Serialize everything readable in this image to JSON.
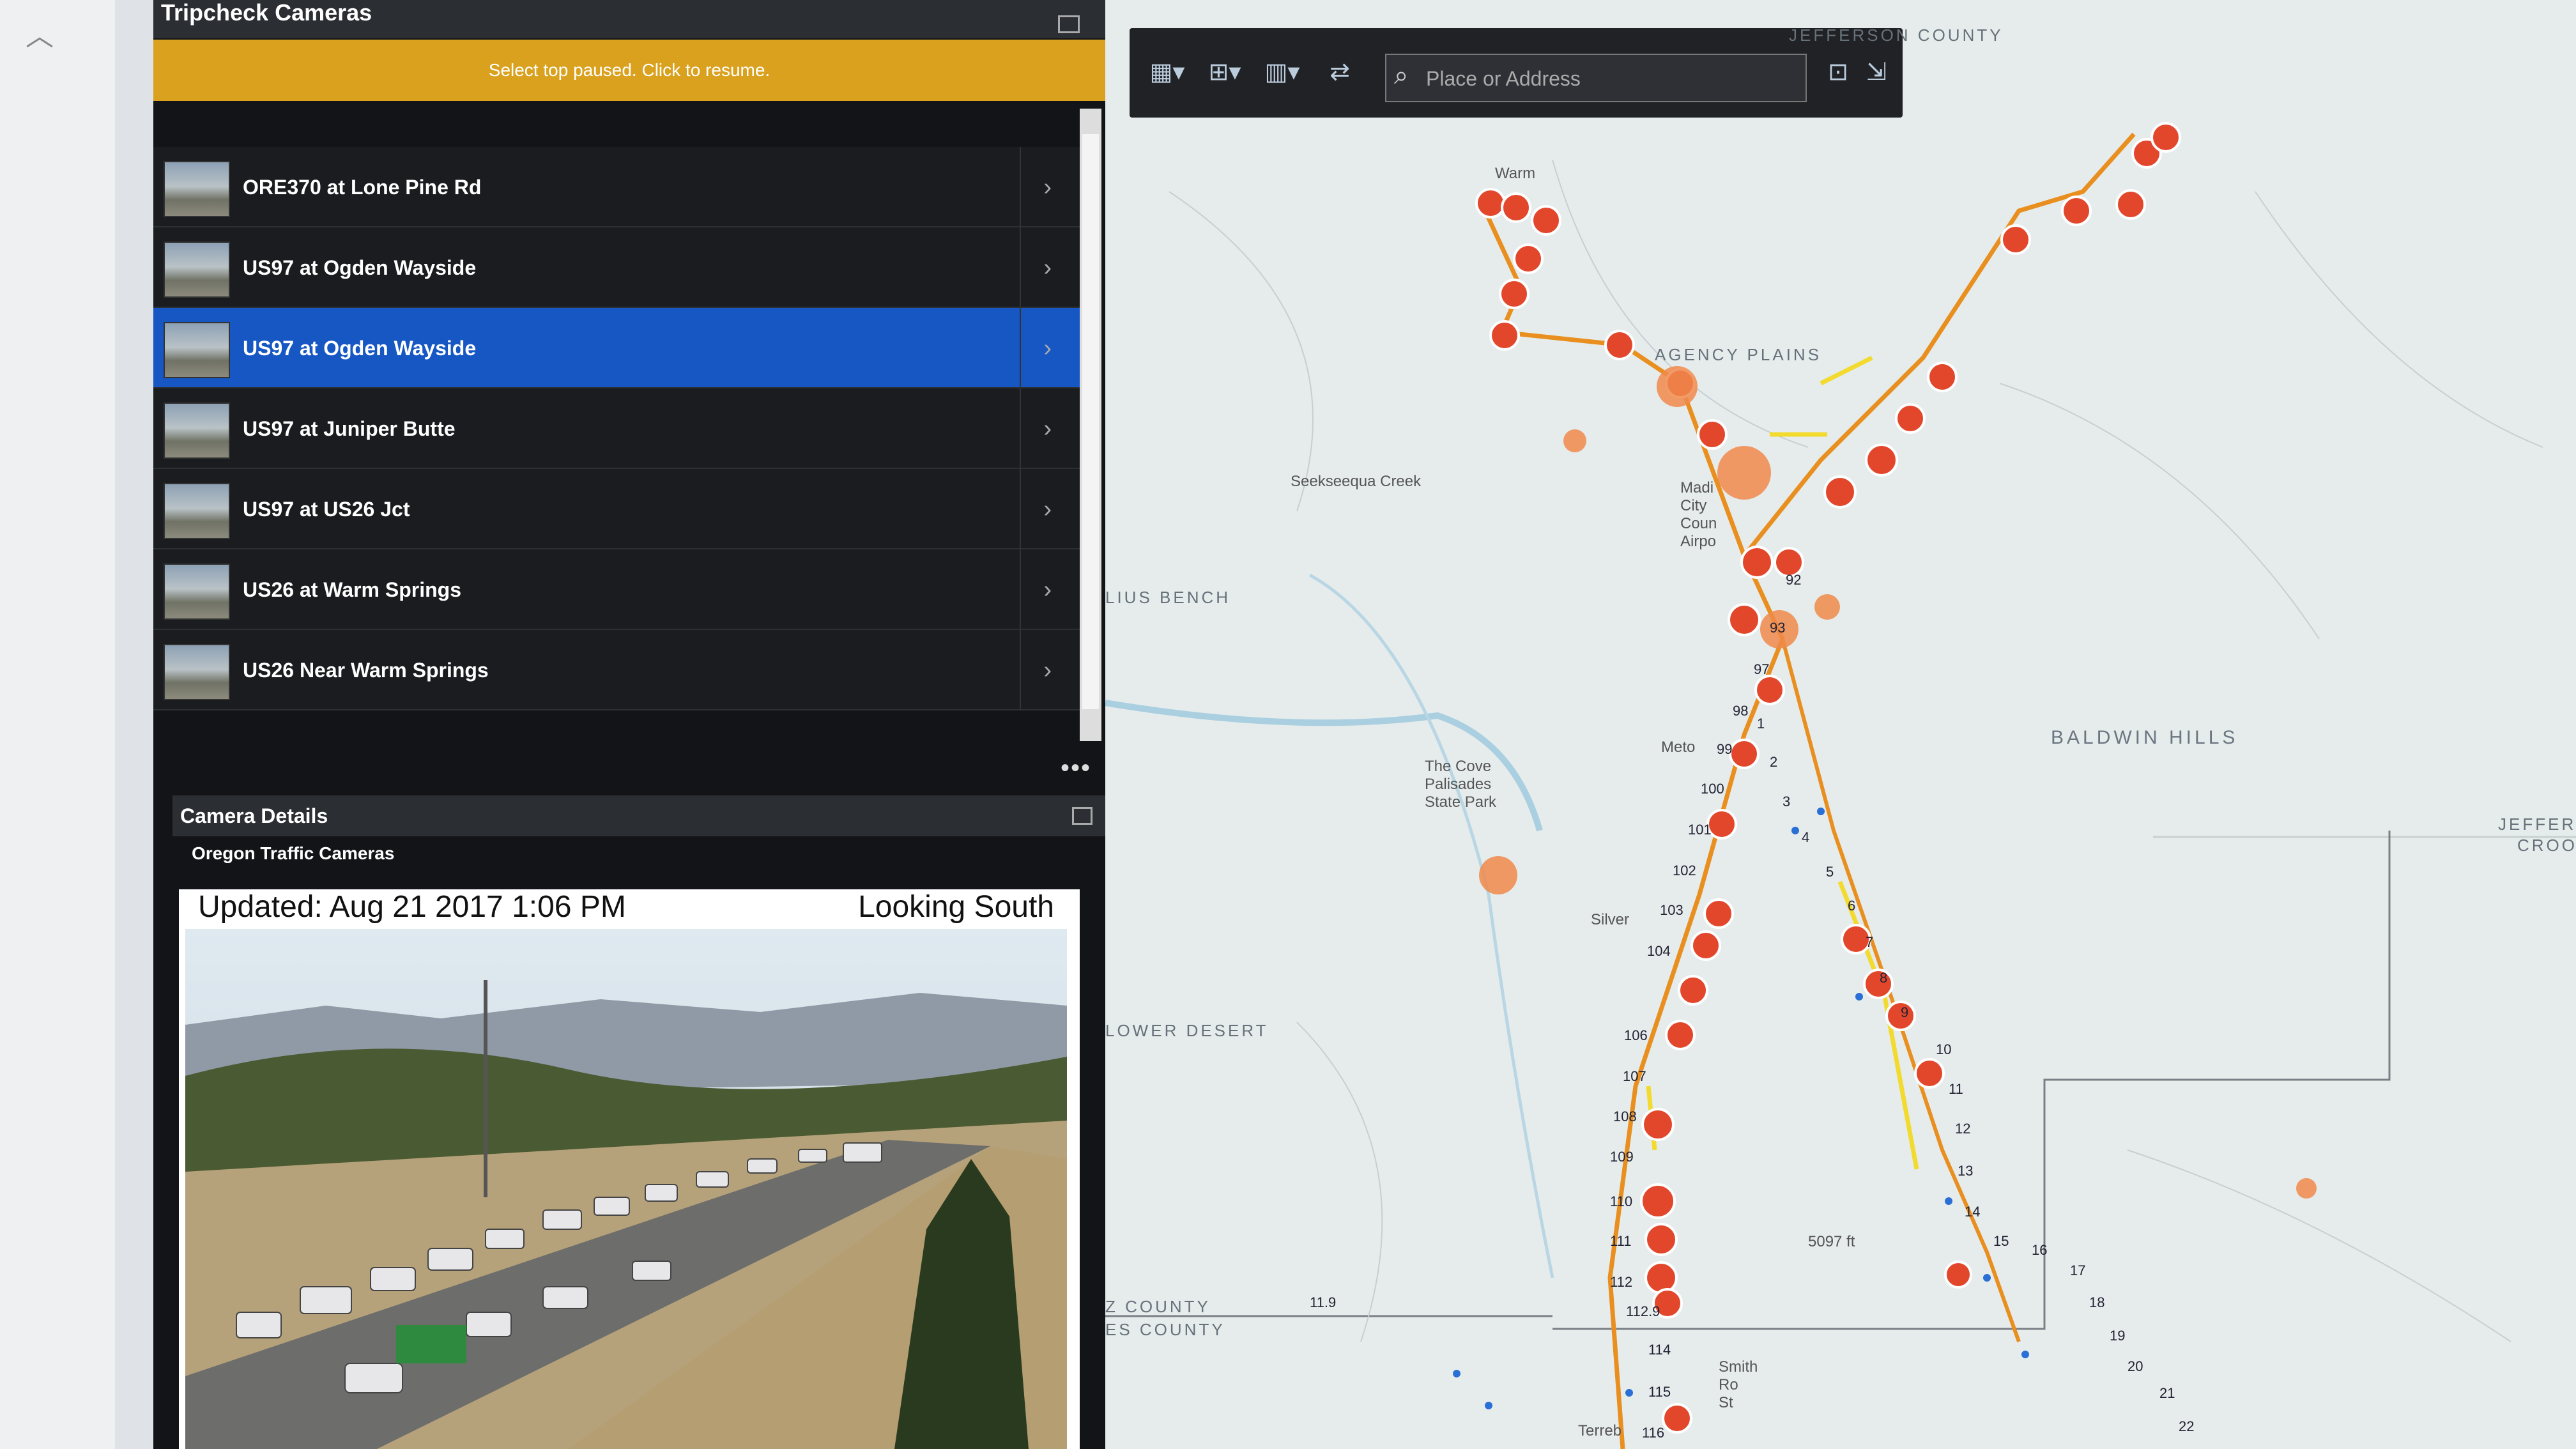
{
  "cameras_panel": {
    "title": "Tripcheck Cameras",
    "notice": "Select top paused. Click to resume.",
    "items": [
      {
        "label": "ORE370 at Lone Pine Rd"
      },
      {
        "label": "US97 at Ogden Wayside"
      },
      {
        "label": "US97 at Ogden Wayside",
        "selected": true
      },
      {
        "label": "US97 at Juniper Butte"
      },
      {
        "label": "US97 at US26 Jct"
      },
      {
        "label": "US26 at Warm Springs"
      },
      {
        "label": "US26 Near Warm Springs"
      }
    ],
    "more": "•••"
  },
  "camera_details": {
    "title": "Camera Details",
    "source": "Oregon Traffic Cameras",
    "updated": "Updated: Aug 21 2017  1:06 PM",
    "direction": "Looking South"
  },
  "map": {
    "search_placeholder": "Place or Address",
    "toolbar": [
      "grid-icon",
      "hierarchy-icon",
      "chart-icon",
      "layers-icon"
    ],
    "labels": {
      "county_top": "JEFFERSON COUNTY",
      "plains": "AGENCY PLAINS",
      "bench": "LIUS BENCH",
      "desert": "LOWER DESERT",
      "hills": "BALDWIN HILLS",
      "jefferson": "JEFFERS",
      "croo": "CROO",
      "county_a": "Z COUNTY",
      "county_b": "ES COUNTY",
      "warm": "Warm",
      "creek": "Seekseequa Creek",
      "cove": "The Cove\nPalisades\nState Park",
      "airport": "Madi\nCity\nCoun\nAirpo",
      "metolius": "Meto",
      "silver": "Silver",
      "smith": "Smith\nRo\nSt",
      "terrebonne": "Terreb",
      "elev": "5097 ft"
    },
    "mileposts": [
      "92",
      "93",
      "97",
      "98",
      "99",
      "100",
      "101",
      "102",
      "103",
      "104",
      "106",
      "107",
      "108",
      "109",
      "110",
      "111",
      "112",
      "112.9",
      "114",
      "115",
      "116",
      "1",
      "2",
      "3",
      "4",
      "5",
      "6",
      "7",
      "8",
      "9",
      "10",
      "11",
      "12",
      "13",
      "14",
      "15",
      "16",
      "17",
      "18",
      "19",
      "20",
      "21",
      "22",
      "11.9"
    ]
  }
}
